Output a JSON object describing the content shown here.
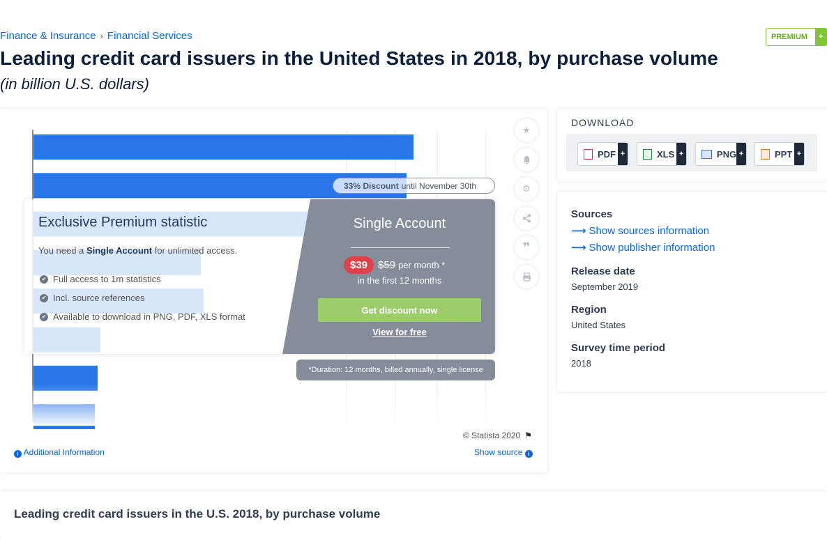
{
  "breadcrumb": {
    "items": [
      "Finance & Insurance",
      "Financial Services"
    ],
    "separator": "›"
  },
  "premium_badge": {
    "label": "PREMIUM",
    "plus": "+"
  },
  "title": "Leading credit card issuers in the United States in 2018, by purchase volume",
  "subtitle": "(in billion U.S. dollars)",
  "chart_data": {
    "type": "bar",
    "orientation": "horizontal",
    "note": "Values are obscured by a premium overlay; bar lengths estimated, axis unlabeled",
    "series": [
      {
        "values": [
          545,
          535,
          428,
          240,
          244,
          96,
          92,
          88
        ]
      }
    ],
    "grid": true,
    "bar_color": "#2876e8"
  },
  "overlay": {
    "title": "Exclusive Premium statistic",
    "need_prefix": "You need a",
    "need_bold": "Single Account",
    "need_suffix": "for unlimited access.",
    "features": [
      "Full access to 1m statistics",
      "Incl. source references",
      "Available to download in PNG, PDF, XLS format"
    ],
    "plan_name": "Single Account",
    "price_new": "$39",
    "price_old": "$59",
    "price_per": "per month *",
    "first_months": "in the first 12 months",
    "discount_button": "Get discount now",
    "view_free": "View for free",
    "discount_pill_bold": "33% Discount",
    "discount_pill_rest": "until November 30th",
    "duration_note": "*Duration: 12 months, billed annually, single license"
  },
  "chart_footer": {
    "copyright": "© Statista 2020",
    "additional_info": "Additional Information",
    "show_source": "Show source"
  },
  "tools": [
    "star-icon",
    "bell-icon",
    "gear-icon",
    "share-icon",
    "quote-icon",
    "print-icon"
  ],
  "download": {
    "title": "DOWNLOAD",
    "formats": [
      {
        "label": "PDF",
        "color": "#d9342b"
      },
      {
        "label": "XLS",
        "color": "#1e8d3a"
      },
      {
        "label": "PNG",
        "color": "#3a6fd8"
      },
      {
        "label": "PPT",
        "color": "#e0782a"
      }
    ],
    "plus": "+"
  },
  "info": {
    "sources_heading": "Sources",
    "show_sources": "Show sources information",
    "show_publisher": "Show publisher information",
    "release_heading": "Release date",
    "release_value": "September 2019",
    "region_heading": "Region",
    "region_value": "United States",
    "survey_heading": "Survey time period",
    "survey_value": "2018"
  },
  "bottom": {
    "title": "Leading credit card issuers in the U.S. 2018, by purchase volume"
  },
  "colors": {
    "accent": "#0666e5",
    "premium_green": "#7fc534",
    "bar_blue": "#2876e8",
    "overlay_gray": "#848d99",
    "price_red": "#e0404a"
  }
}
